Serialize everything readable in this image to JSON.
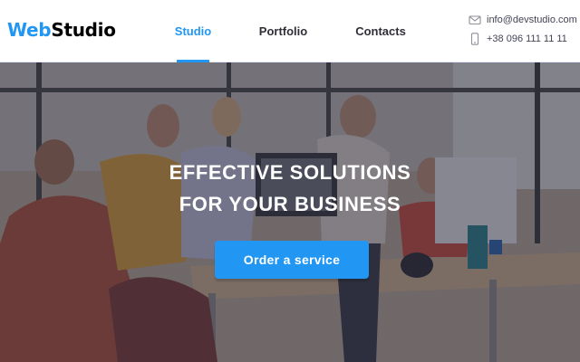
{
  "brand": {
    "logo_part1": "Web",
    "logo_part2": "Studio",
    "accent_color": "#2196f3",
    "text_color": "#000000"
  },
  "nav": {
    "items": [
      {
        "label": "Studio",
        "active": true
      },
      {
        "label": "Portfolio",
        "active": false
      },
      {
        "label": "Contacts",
        "active": false
      }
    ]
  },
  "contacts": {
    "email": "info@devstudio.com",
    "email_icon": "envelope-icon",
    "phone": "+38 096 111 11 11",
    "phone_icon": "smartphone-icon"
  },
  "hero": {
    "title_line1": "Effective solutions",
    "title_line2": "for your business",
    "button_label": "Order a service",
    "overlay_color": "#2e2f42",
    "image": "team-working-in-office-photo"
  }
}
